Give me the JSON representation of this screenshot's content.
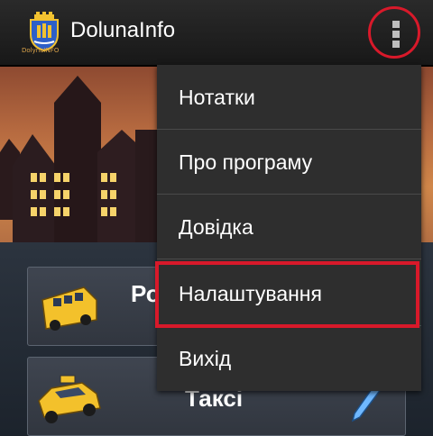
{
  "app": {
    "title": "DolunaInfo",
    "logo_caption": "DolynaINFO"
  },
  "icons": {
    "logo": "city-crest-logo",
    "overflow": "overflow-menu-icon",
    "card1": "school-bus-icon",
    "card2": "taxi-car-icon",
    "card2_action": "pencil-icon"
  },
  "cards": [
    {
      "label": "Ро"
    },
    {
      "label": "Таксі"
    }
  ],
  "menu": {
    "items": [
      {
        "label": "Нотатки"
      },
      {
        "label": "Про програму"
      },
      {
        "label": "Довідка"
      },
      {
        "label": "Налаштування"
      },
      {
        "label": "Вихід"
      }
    ]
  },
  "colors": {
    "highlight": "#d8192a",
    "menu_bg": "#2e2e2e",
    "actionbar_bg": "#1c1c1c"
  }
}
